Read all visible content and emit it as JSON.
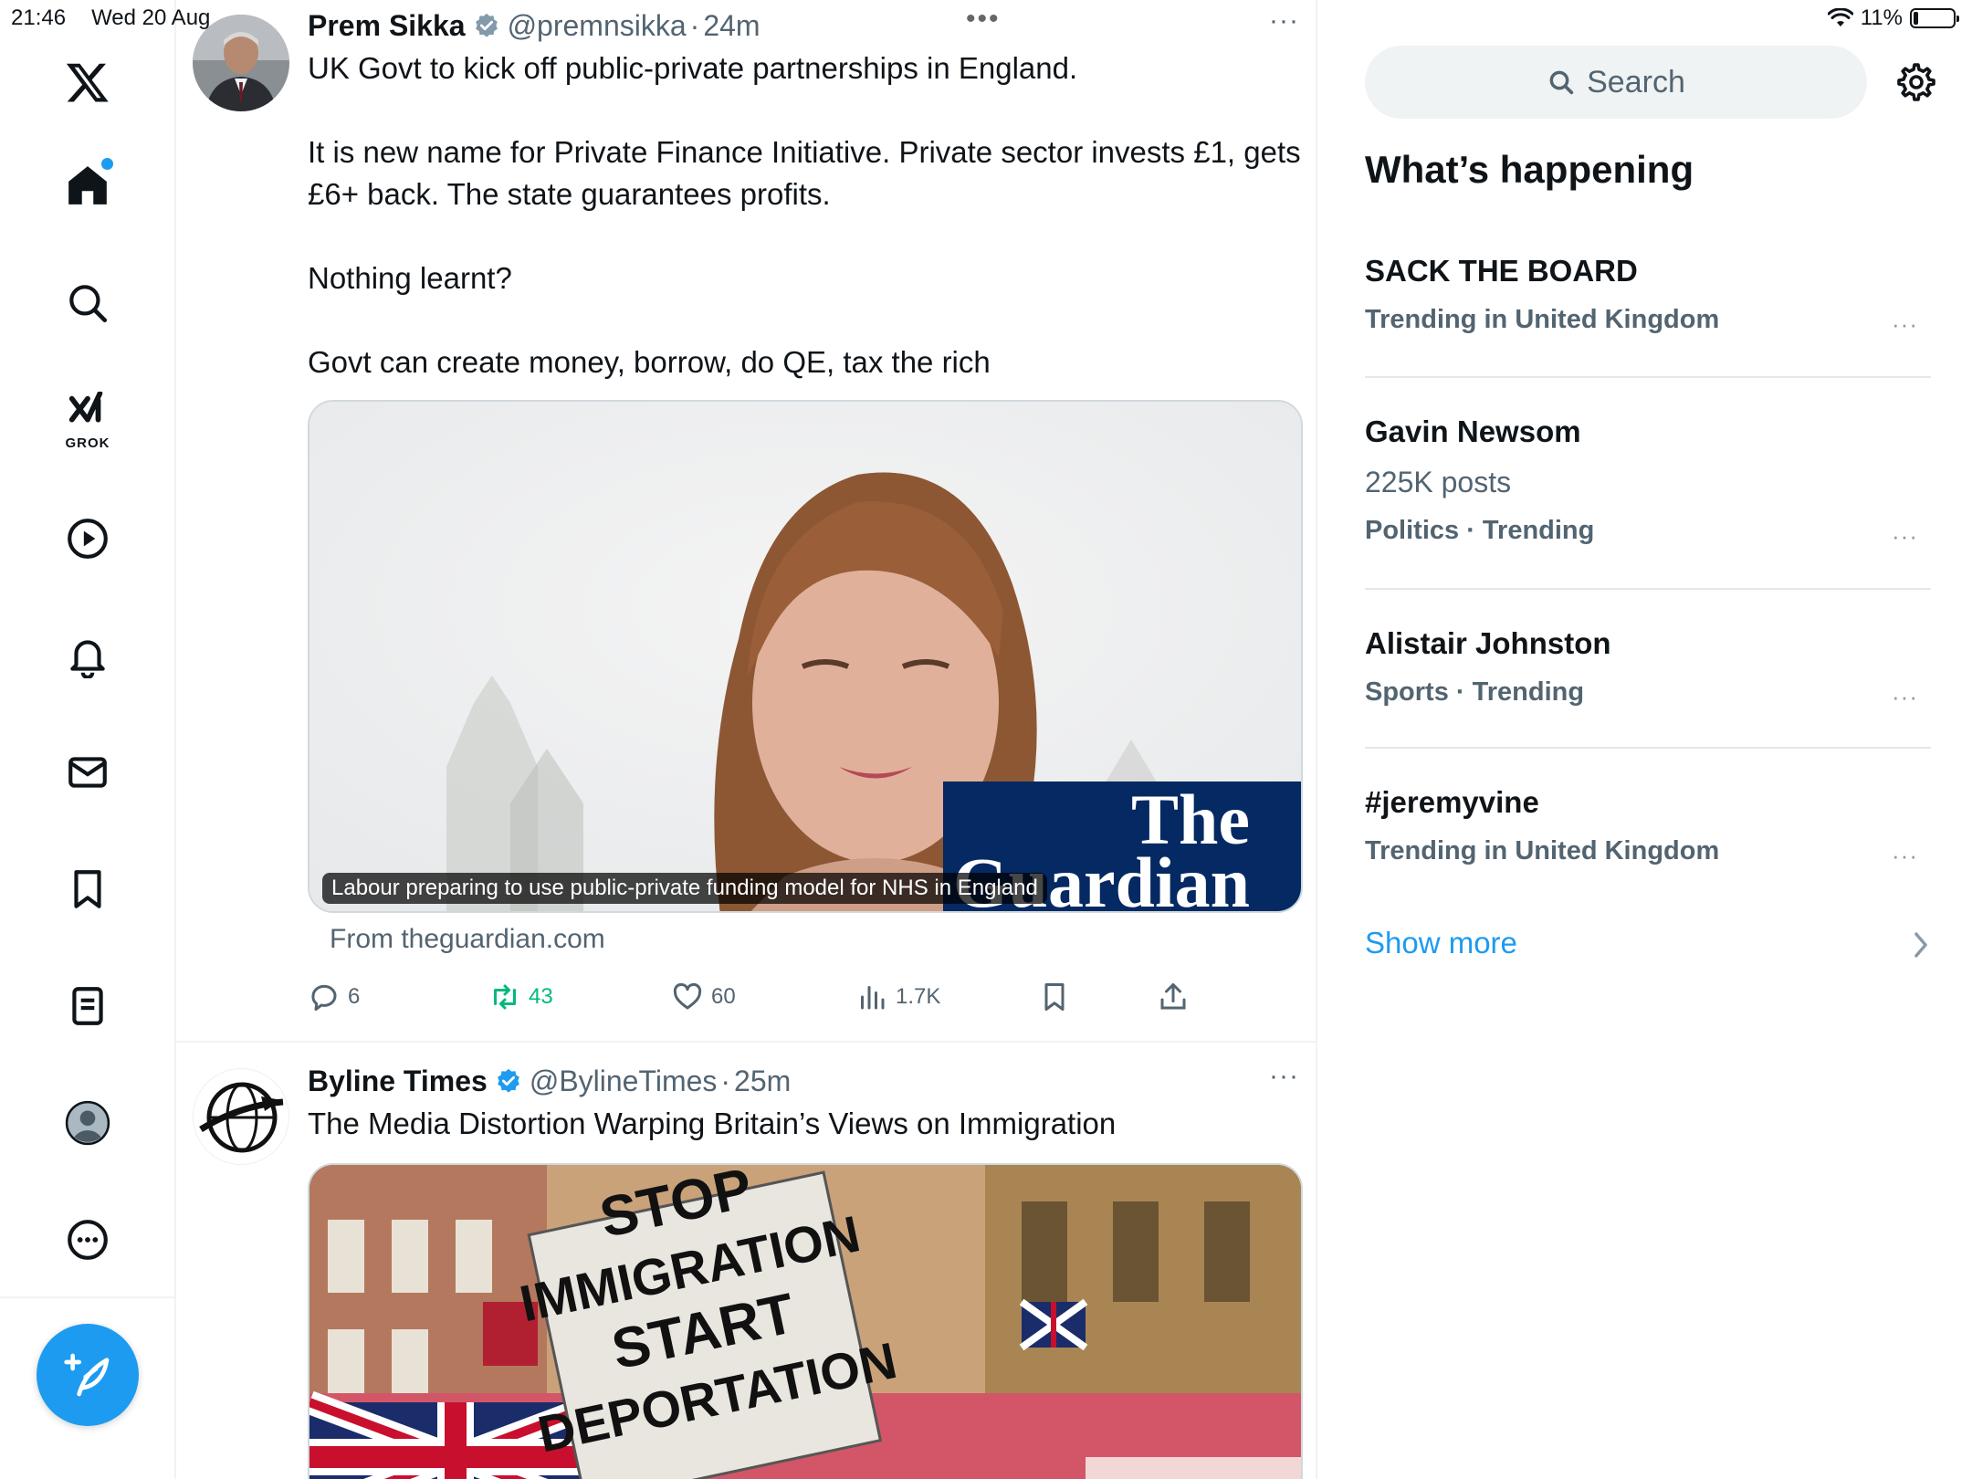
{
  "status_bar": {
    "time": "21:46",
    "date": "Wed 20 Aug",
    "battery": "11%",
    "more_dots": "•••"
  },
  "nav": {
    "logo": "x-logo-icon",
    "grok_label": "GROK",
    "items": [
      "home",
      "explore",
      "grok",
      "video",
      "notifications",
      "messages",
      "bookmarks",
      "lists",
      "profile",
      "more"
    ]
  },
  "timeline": {
    "tweets": [
      {
        "name": "Prem Sikka",
        "handle": "@premnsikka",
        "dot": "·",
        "time": "24m",
        "more": "···",
        "paragraphs": [
          "UK Govt to kick off public-private partnerships in England.",
          "It is new name for Private Finance Initiative. Private sector invests £1, gets £6+ back. The state guarantees  profits.",
          "Nothing learnt?",
          "Govt can create money, borrow, do QE, tax the rich"
        ],
        "card": {
          "caption": "Labour preparing to use public-private funding model for NHS in England",
          "logo_line1": "The",
          "logo_line2": "Guardian",
          "from": "From theguardian.com"
        },
        "actions": {
          "replies": "6",
          "reposts": "43",
          "likes": "60",
          "views": "1.7K"
        }
      },
      {
        "name": "Byline Times",
        "handle": "@BylineTimes",
        "dot": "·",
        "time": "25m",
        "more": "···",
        "text": "The Media Distortion Warping Britain’s Views on Immigration",
        "sign_lines": [
          "STOP",
          "IMMIGRATION",
          "START",
          "DEPORTATION"
        ]
      }
    ]
  },
  "sidebar_right": {
    "search_placeholder": "Search",
    "section_title": "What’s happening",
    "trends": [
      {
        "name": "SACK THE BOARD",
        "meta": "Trending in United Kingdom",
        "posts": ""
      },
      {
        "name": "Gavin Newsom",
        "posts": "225K posts",
        "meta": "Politics · Trending"
      },
      {
        "name": "Alistair Johnston",
        "meta": "Sports · Trending",
        "posts": ""
      },
      {
        "name": "#jeremyvine",
        "meta": "Trending in United Kingdom",
        "posts": ""
      }
    ],
    "trend_more": "···",
    "show_more": "Show more"
  },
  "colors": {
    "accent": "#1d9bf0",
    "text_secondary": "#536471",
    "repost_active": "#00ba7c",
    "guardian_blue": "#052962"
  }
}
